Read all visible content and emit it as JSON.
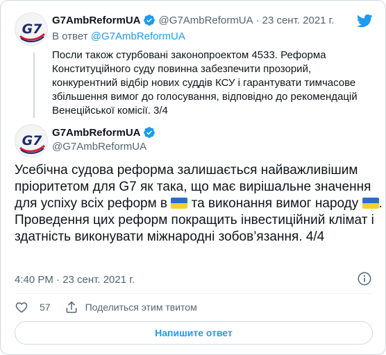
{
  "colors": {
    "accent": "#1d9bf0",
    "secondary_text": "#536471",
    "border": "#cfd9de",
    "g7_red": "#d51f2e",
    "g7_navy": "#1b2b6b"
  },
  "parent_tweet": {
    "display_name": "G7AmbReformUA",
    "handle": "@G7AmbReformUA",
    "separator": "·",
    "date": "23 сент. 2021 г.",
    "reply_prefix": "В ответ",
    "reply_to": "@G7AmbReformUA",
    "text": "Посли також стурбовані законопроектом 4533. Реформа Конституційного суду повинна забезпечити прозорий, конкурентний відбір нових суддів КСУ і гарантувати тимчасове збільшення вимог до голосування, відповідно до рекомендацій Венеційської комісії. 3/4",
    "avatar_text": "G7"
  },
  "main_tweet": {
    "display_name": "G7AmbReformUA",
    "handle": "@G7AmbReformUA",
    "avatar_text": "G7",
    "text_part1": "Усебічна судова реформа залишається найважливішим пріоритетом для G7 як така, що має вирішальне значення для успіху всіх реформ в ",
    "text_part2": " та виконання вимог народу ",
    "text_part3": ". Проведення цих реформ покращить інвестиційний клімат і здатність виконувати міжнародні зобов’язання. 4/4",
    "timestamp": "4:40 PM · 23 сент. 2021 г."
  },
  "actions": {
    "like_count": "57",
    "share_label": "Поделиться этим твитом"
  },
  "reply_button_label": "Напишите ответ",
  "icons": {
    "logo": "twitter-bird-icon",
    "verified": "verified-badge-icon",
    "info": "info-icon",
    "like": "heart-icon",
    "share": "share-icon",
    "flag": "ukraine-flag-emoji"
  }
}
